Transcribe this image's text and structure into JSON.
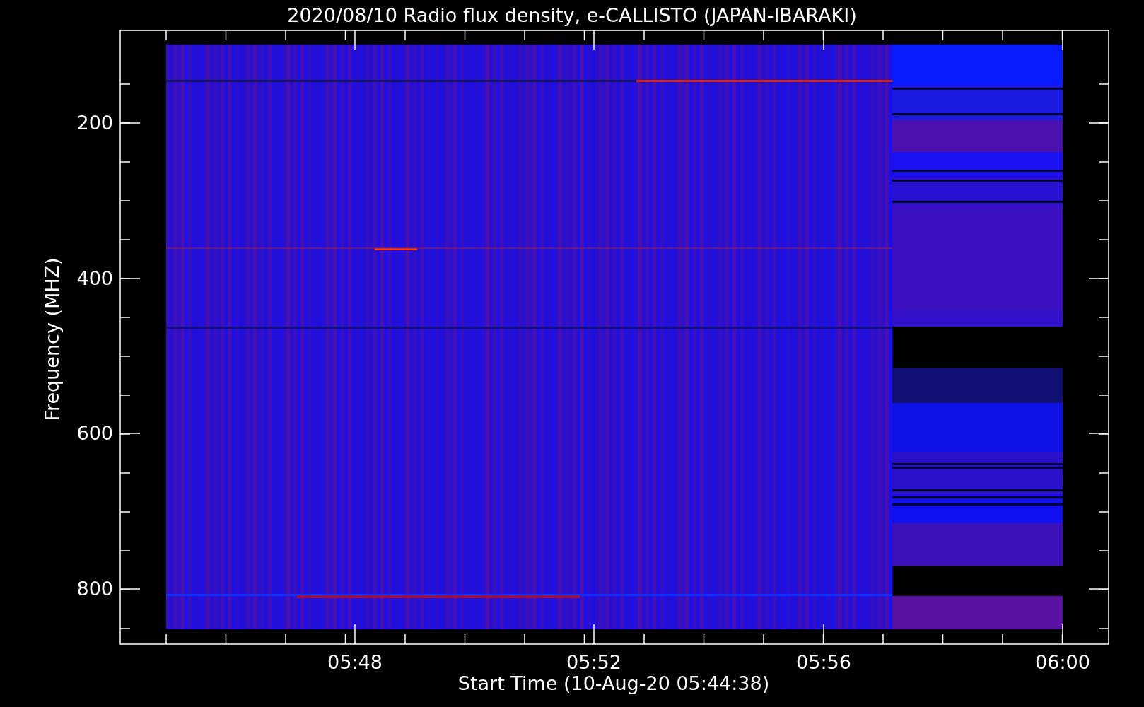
{
  "title": "2020/08/10  Radio flux density, e-CALLISTO (JAPAN-IBARAKI)",
  "ylabel": "Frequency (MHZ)",
  "xlabel": "Start Time (10-Aug-20 05:44:38)",
  "yticks": [
    "200",
    "400",
    "600",
    "800"
  ],
  "xticks": [
    "05:48",
    "05:52",
    "05:56",
    "06:00"
  ]
}
